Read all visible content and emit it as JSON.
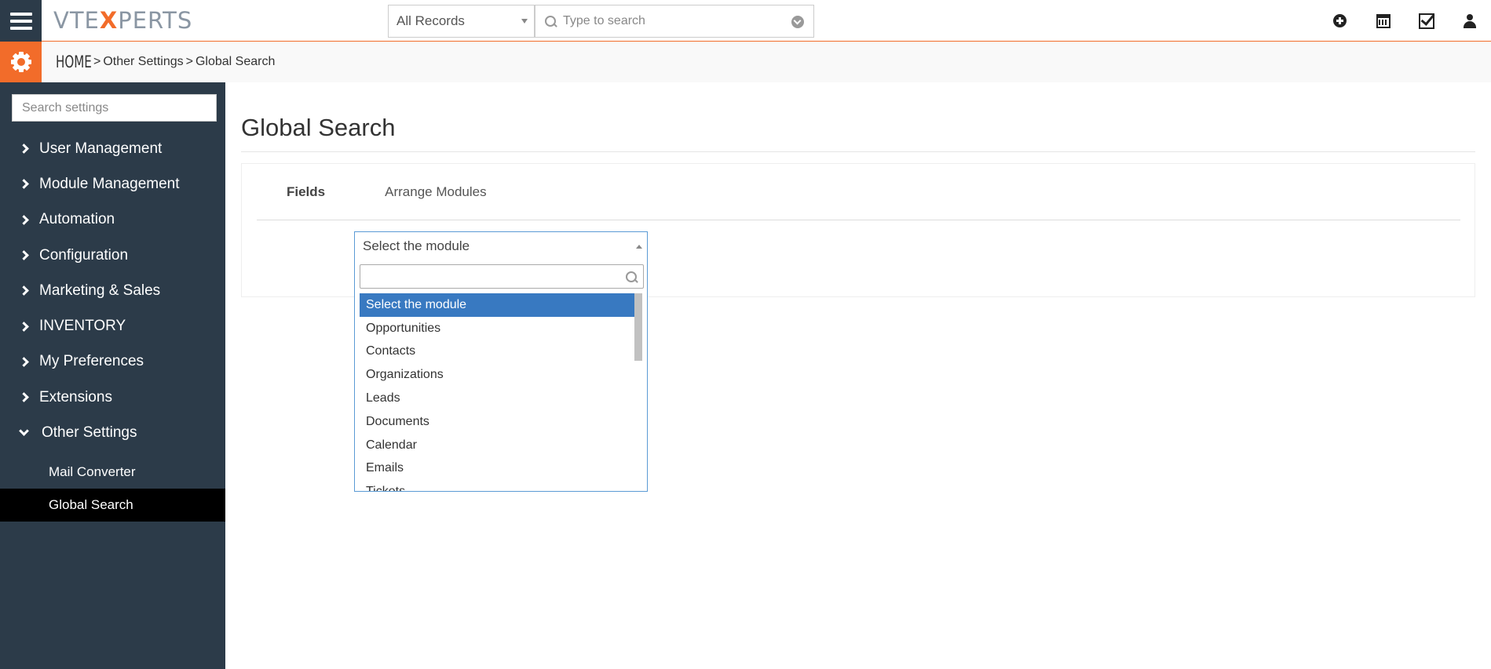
{
  "topbar": {
    "logo_prefix": "VTE",
    "logo_x": "X",
    "logo_suffix": "PERTS",
    "record_filter": "All Records",
    "search_placeholder": "Type to search",
    "icons": [
      "plus-circle-icon",
      "calendar-icon",
      "check-square-icon",
      "user-icon"
    ]
  },
  "breadcrumb": {
    "home": "HOME",
    "sep": ">",
    "items": [
      "Other Settings",
      "Global Search"
    ]
  },
  "sidebar": {
    "search_placeholder": "Search settings",
    "items": [
      {
        "label": "User Management"
      },
      {
        "label": "Module Management"
      },
      {
        "label": "Automation"
      },
      {
        "label": "Configuration"
      },
      {
        "label": "Marketing & Sales"
      },
      {
        "label": "INVENTORY"
      },
      {
        "label": "My Preferences"
      },
      {
        "label": "Extensions"
      },
      {
        "label": "Other Settings"
      }
    ],
    "sub_items": [
      {
        "label": "Mail Converter"
      },
      {
        "label": "Global Search"
      }
    ]
  },
  "main": {
    "title": "Global Search",
    "tabs": [
      {
        "label": "Fields"
      },
      {
        "label": "Arrange Modules"
      }
    ],
    "module_select": {
      "value": "Select the module",
      "options": [
        "Select the module",
        "Opportunities",
        "Contacts",
        "Organizations",
        "Leads",
        "Documents",
        "Calendar",
        "Emails",
        "Tickets"
      ]
    }
  },
  "colors": {
    "accent": "#f26c2a",
    "sidebar_bg": "#2c3b49",
    "selected_option": "#3879c1"
  }
}
